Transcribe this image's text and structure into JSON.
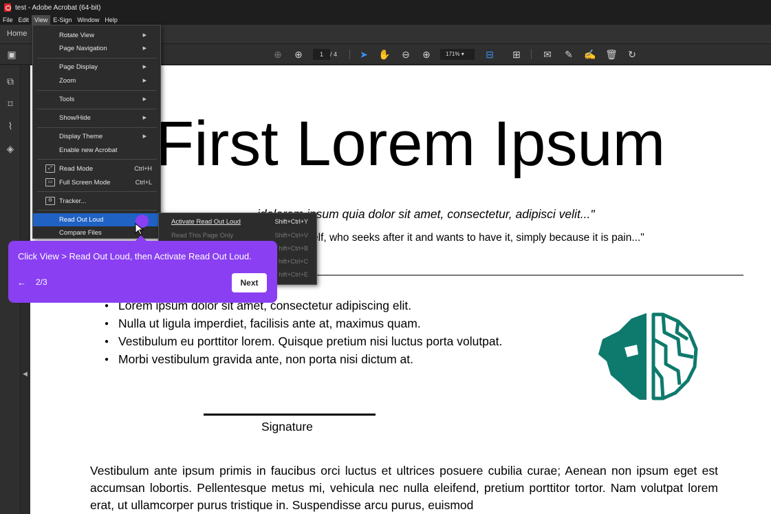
{
  "window": {
    "title": "test - Adobe Acrobat (64-bit)"
  },
  "menubar": [
    "File",
    "Edit",
    "View",
    "E-Sign",
    "Window",
    "Help"
  ],
  "tabbar": {
    "home": "Home"
  },
  "toolbar": {
    "page_current": "1",
    "page_total": "/ 4",
    "zoom": "171%"
  },
  "view_menu": {
    "items": [
      {
        "label": "Rotate View",
        "submenu": true
      },
      {
        "label": "Page Navigation",
        "submenu": true
      },
      {
        "label": "Page Display",
        "submenu": true
      },
      {
        "label": "Zoom",
        "submenu": true
      },
      {
        "label": "Tools",
        "submenu": true
      },
      {
        "label": "Show/Hide",
        "submenu": true
      },
      {
        "label": "Display Theme",
        "submenu": true
      },
      {
        "label": "Enable new Acrobat"
      },
      {
        "label": "Read Mode",
        "shortcut": "Ctrl+H"
      },
      {
        "label": "Full Screen Mode",
        "shortcut": "Ctrl+L"
      },
      {
        "label": "Tracker..."
      },
      {
        "label": "Read Out Loud",
        "submenu": true
      },
      {
        "label": "Compare Files"
      }
    ]
  },
  "read_out_loud_submenu": {
    "items": [
      {
        "label": "Activate Read Out Loud",
        "shortcut": "Shift+Ctrl+Y"
      },
      {
        "label": "Read This Page Only",
        "shortcut": "Shift+Ctrl+V"
      },
      {
        "label": "",
        "shortcut": "hift+Ctrl+B"
      },
      {
        "label": "",
        "shortcut": "hift+Ctrl+C"
      },
      {
        "label": "",
        "shortcut": "hift+Ctrl+E"
      }
    ]
  },
  "tooltip": {
    "message": "Click View > Read Out Loud, then Activate Read Out Loud.",
    "back": "←",
    "step": "2/3",
    "next": "Next"
  },
  "document": {
    "title": "First Lorem Ipsum",
    "quote1": "idolorem ipsum quia dolor sit amet, consectetur, adipisci velit...\"",
    "quote2": "elf, who seeks after it and wants to have it, simply because it is pain...\"",
    "bullets": [
      "Lorem ipsum dolor sit amet, consectetur adipiscing elit.",
      "Nulla ut ligula imperdiet, facilisis ante at, maximus quam.",
      "Vestibulum eu porttitor lorem. Quisque pretium nisi luctus porta volutpat.",
      "Morbi vestibulum gravida ante, non porta nisi dictum at."
    ],
    "signature_label": "Signature",
    "paragraph": "Vestibulum ante ipsum primis in faucibus orci luctus et ultrices posuere cubilia curae; Aenean non ipsum eget est accumsan lobortis. Pellentesque metus mi, vehicula nec nulla eleifend, pretium porttitor tortor. Nam volutpat lorem erat, ut ullamcorper purus tristique in. Suspendisse arcu purus, euismod"
  },
  "colors": {
    "accent": "#8a3ff2",
    "highlight": "#2062c4",
    "logo": "#0e7a6d"
  }
}
